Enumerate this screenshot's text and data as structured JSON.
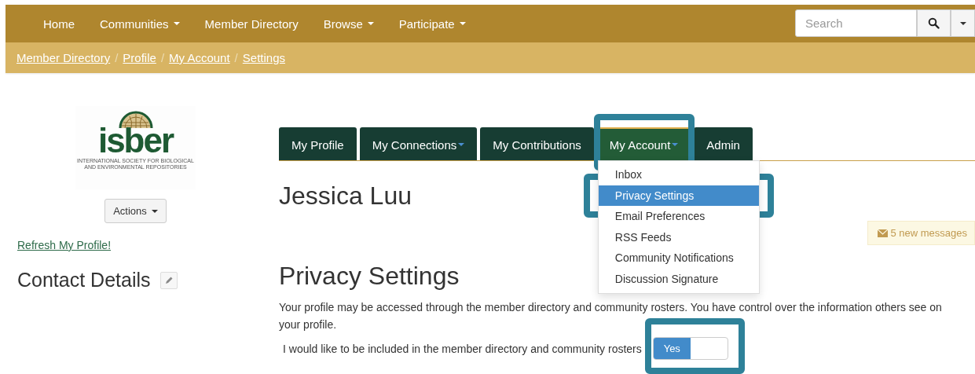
{
  "navbar": {
    "items": [
      {
        "label": "Home",
        "dropdown": false
      },
      {
        "label": "Communities",
        "dropdown": true
      },
      {
        "label": "Member Directory",
        "dropdown": false
      },
      {
        "label": "Browse",
        "dropdown": true
      },
      {
        "label": "Participate",
        "dropdown": true
      }
    ],
    "search": {
      "placeholder": "Search"
    }
  },
  "breadcrumbs": [
    {
      "label": "Member Directory",
      "separator": "/"
    },
    {
      "label": "Profile",
      "separator": "/"
    },
    {
      "label": "My Account",
      "separator": "/"
    },
    {
      "label": "Settings"
    }
  ],
  "sidebar": {
    "logo": {
      "wordmark": "isber",
      "caption_lines": [
        "INTERNATIONAL SOCIETY FOR BIOLOGICAL",
        "AND ENVIRONMENTAL REPOSITORIES"
      ]
    },
    "actions_button": "Actions",
    "refresh_link": "Refresh My Profile!",
    "contact_heading": "Contact Details"
  },
  "tabs": [
    {
      "label": "My Profile",
      "dropdown": false,
      "selected": false
    },
    {
      "label": "My Connections",
      "dropdown": true,
      "selected": false
    },
    {
      "label": "My Contributions",
      "dropdown": false,
      "selected": false
    },
    {
      "label": "My Account",
      "dropdown": true,
      "selected": true,
      "highlighted": true
    },
    {
      "label": "Admin",
      "dropdown": false,
      "selected": false
    }
  ],
  "account_menu": {
    "items": [
      {
        "label": "Inbox",
        "selected": false
      },
      {
        "label": "Privacy Settings",
        "selected": true,
        "highlighted": true
      },
      {
        "label": "Email Preferences",
        "selected": false
      },
      {
        "label": "RSS Feeds",
        "selected": false
      },
      {
        "label": "Community Notifications",
        "selected": false
      },
      {
        "label": "Discussion Signature",
        "selected": false
      }
    ]
  },
  "profile_name": "Jessica Luu",
  "messages_badge": "5 new messages",
  "privacy": {
    "heading": "Privacy Settings",
    "description": "Your profile may be accessed through the member directory and community rosters. You have control over the information others see on your profile.",
    "directory_option": {
      "label": "I would like to be included in the member directory and community rosters",
      "on": true,
      "on_label": "Yes",
      "highlighted": true
    }
  }
}
